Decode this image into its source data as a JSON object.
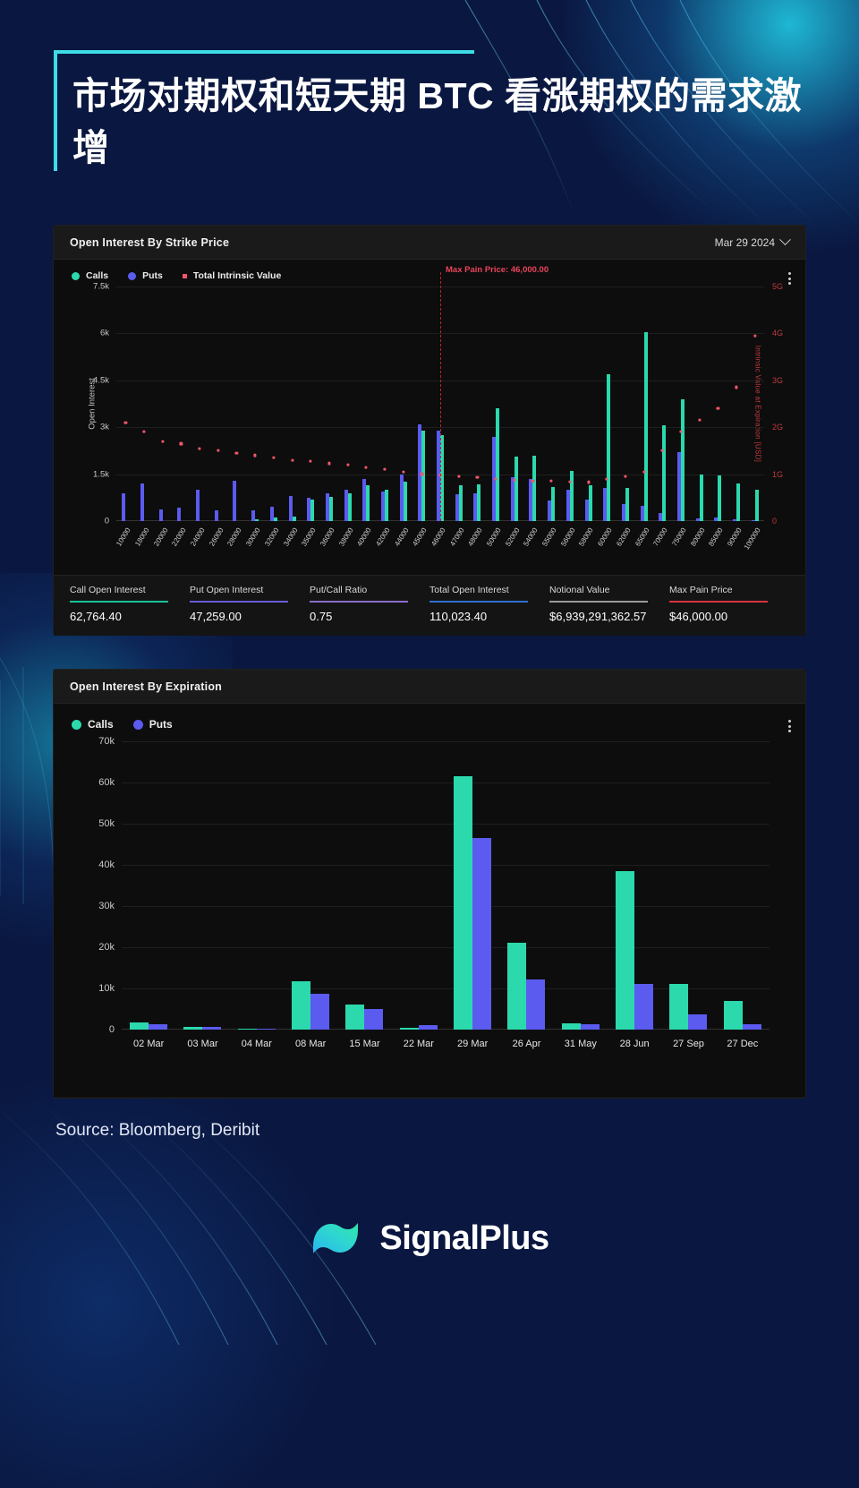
{
  "headline": "市场对期权和短天期 BTC 看涨期权的需求激增",
  "source_note": "Source: Bloomberg, Deribit",
  "brand": {
    "name": "SignalPlus"
  },
  "colors": {
    "calls": "#2bd9ad",
    "puts": "#5b5bef",
    "intrinsic": "#f2556a",
    "max_pain_line": "#b8232d",
    "accent": "#3ddce6",
    "page_bg": "#0a1740",
    "card_bg": "#141414",
    "plot_bg": "#0d0d0d"
  },
  "strike_card": {
    "title": "Open Interest By Strike Price",
    "date_selector": "Mar 29 2024",
    "chevron_icon": "chevron-down-icon",
    "menu_icon": "kebab-menu-icon",
    "legend": [
      {
        "label": "Calls",
        "marker": "circle",
        "color": "#2bd9ad"
      },
      {
        "label": "Puts",
        "marker": "circle",
        "color": "#5b5bef"
      },
      {
        "label": "Total Intrinsic Value",
        "marker": "square",
        "color": "#f2556a"
      }
    ],
    "stats": [
      {
        "label": "Call Open Interest",
        "value": "62,764.40",
        "rule_color": "#17c39a"
      },
      {
        "label": "Put Open Interest",
        "value": "47,259.00",
        "rule_color": "#6a5bd8"
      },
      {
        "label": "Put/Call Ratio",
        "value": "0.75",
        "rule_color": "#8a6fc9"
      },
      {
        "label": "Total Open Interest",
        "value": "110,023.40",
        "rule_color": "#2f6fd0"
      },
      {
        "label": "Notional Value",
        "value": "$6,939,291,362.57",
        "rule_color": "#9a9a9a"
      },
      {
        "label": "Max Pain Price",
        "value": "$46,000.00",
        "rule_color": "#d8333f"
      }
    ]
  },
  "expiry_card": {
    "title": "Open Interest By Expiration",
    "menu_icon": "kebab-menu-icon",
    "legend": [
      {
        "label": "Calls",
        "marker": "circle",
        "color": "#2bd9ad"
      },
      {
        "label": "Puts",
        "marker": "circle",
        "color": "#5b5bef"
      }
    ]
  },
  "chart_data": [
    {
      "type": "bar",
      "title": "Open Interest By Strike Price",
      "xlabel": "",
      "ylabel": "Open Interest",
      "y2label": "Intrinsic Value at Expiration [USD]",
      "ylim": [
        0,
        7500
      ],
      "yticks": [
        0,
        1500,
        3000,
        4500,
        6000,
        7500
      ],
      "ytick_labels": [
        "0",
        "1.5k",
        "3k",
        "4.5k",
        "6k",
        "7.5k"
      ],
      "y2lim": [
        0,
        5000000000
      ],
      "y2ticks": [
        0,
        1000000000,
        2000000000,
        3000000000,
        4000000000,
        5000000000
      ],
      "y2tick_labels": [
        "0",
        "1G",
        "2G",
        "3G",
        "4G",
        "5G"
      ],
      "grid": true,
      "legend_position": "top-left",
      "annotations": [
        {
          "text": "Max Pain Price: 46,000.00",
          "type": "vline",
          "x": "46000",
          "color": "#b8232d"
        }
      ],
      "categories": [
        "10000",
        "18000",
        "20000",
        "22000",
        "24000",
        "26000",
        "28000",
        "30000",
        "32000",
        "34000",
        "35000",
        "36000",
        "38000",
        "40000",
        "42000",
        "44000",
        "45000",
        "46000",
        "47000",
        "48000",
        "50000",
        "52000",
        "54000",
        "55000",
        "56000",
        "58000",
        "60000",
        "62000",
        "65000",
        "70000",
        "75000",
        "80000",
        "85000",
        "90000",
        "100000"
      ],
      "series": [
        {
          "name": "Calls",
          "color": "#2bd9ad",
          "values": [
            0,
            0,
            0,
            0,
            0,
            0,
            0,
            60,
            110,
            130,
            700,
            780,
            900,
            1150,
            1000,
            1250,
            2900,
            2750,
            1150,
            1180,
            3600,
            2050,
            2100,
            1100,
            1600,
            1150,
            4700,
            1050,
            6050,
            3050,
            3900,
            1500,
            1450,
            1200,
            1000
          ]
        },
        {
          "name": "Puts",
          "color": "#5b5bef",
          "values": [
            900,
            1200,
            380,
            420,
            1000,
            350,
            1300,
            330,
            450,
            800,
            750,
            900,
            1000,
            1350,
            950,
            1500,
            3100,
            2900,
            850,
            900,
            2700,
            1400,
            1350,
            650,
            1000,
            700,
            1050,
            550,
            480,
            250,
            2200,
            100,
            120,
            60,
            40
          ]
        }
      ],
      "overlay": {
        "name": "Total Intrinsic Value",
        "color": "#f2556a",
        "axis": "right",
        "marker": "square",
        "values": [
          2100000000,
          1900000000,
          1700000000,
          1650000000,
          1550000000,
          1500000000,
          1450000000,
          1400000000,
          1350000000,
          1300000000,
          1270000000,
          1230000000,
          1200000000,
          1150000000,
          1100000000,
          1050000000,
          1000000000,
          980000000,
          950000000,
          930000000,
          900000000,
          880000000,
          860000000,
          850000000,
          840000000,
          830000000,
          900000000,
          950000000,
          1050000000,
          1500000000,
          1900000000,
          2150000000,
          2400000000,
          2850000000,
          3950000000
        ]
      }
    },
    {
      "type": "bar",
      "title": "Open Interest By Expiration",
      "xlabel": "",
      "ylabel": "",
      "ylim": [
        0,
        70000
      ],
      "yticks": [
        0,
        10000,
        20000,
        30000,
        40000,
        50000,
        60000,
        70000
      ],
      "ytick_labels": [
        "0",
        "10k",
        "20k",
        "30k",
        "40k",
        "50k",
        "60k",
        "70k"
      ],
      "grid": true,
      "legend_position": "top-left",
      "categories": [
        "02 Mar",
        "03 Mar",
        "04 Mar",
        "08 Mar",
        "15 Mar",
        "22 Mar",
        "29 Mar",
        "26 Apr",
        "31 May",
        "28 Jun",
        "27 Sep",
        "27 Dec"
      ],
      "series": [
        {
          "name": "Calls",
          "color": "#2bd9ad",
          "values": [
            1800,
            700,
            300,
            11700,
            6000,
            400,
            61500,
            21000,
            1600,
            38500,
            11000,
            7000
          ]
        },
        {
          "name": "Puts",
          "color": "#5b5bef",
          "values": [
            1400,
            600,
            150,
            8700,
            5000,
            1100,
            46500,
            12200,
            1300,
            11000,
            3800,
            1400
          ]
        }
      ]
    }
  ]
}
